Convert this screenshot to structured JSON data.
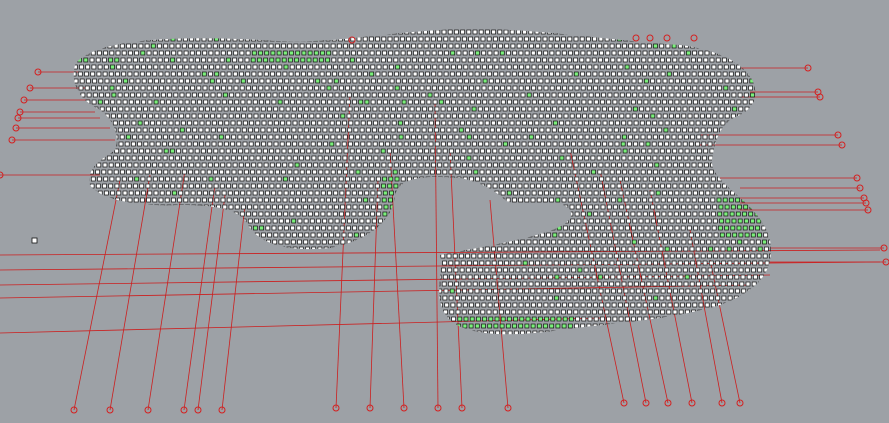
{
  "viewport": {
    "background": "#9da1a6",
    "grid_point_fill": "#ffffff",
    "grid_point_stroke": "#111111",
    "selected_point_color": "#7cf07c",
    "leader_line_color": "#cc1f1f",
    "anchor_color": "#d42020"
  }
}
